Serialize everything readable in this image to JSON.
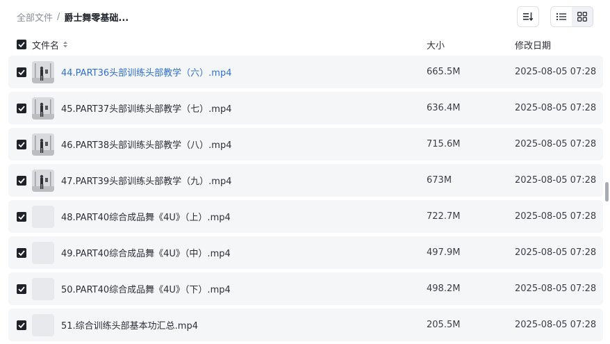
{
  "breadcrumb": {
    "root": "全部文件",
    "separator": "/",
    "current": "爵士舞零基础..."
  },
  "toolbar": {
    "sort_icon": "sort-icon",
    "list_view_icon": "list-view-icon",
    "grid_view_icon": "grid-view-icon"
  },
  "table": {
    "headers": {
      "name": "文件名",
      "size": "大小",
      "modified": "修改日期"
    },
    "rows": [
      {
        "name": "44.PART36头部训练头部教学（六）.mp4",
        "size": "665.5M",
        "modified": "2025-08-05 07:28",
        "thumb": "video",
        "highlight": true
      },
      {
        "name": "45.PART37头部训练头部教学（七）.mp4",
        "size": "636.4M",
        "modified": "2025-08-05 07:28",
        "thumb": "video",
        "highlight": false
      },
      {
        "name": "46.PART38头部训练头部教学（八）.mp4",
        "size": "715.6M",
        "modified": "2025-08-05 07:28",
        "thumb": "video",
        "highlight": false
      },
      {
        "name": "47.PART39头部训练头部教学（九）.mp4",
        "size": "673M",
        "modified": "2025-08-05 07:28",
        "thumb": "video",
        "highlight": false
      },
      {
        "name": "48.PART40综合成品舞《4U》（上）.mp4",
        "size": "722.7M",
        "modified": "2025-08-05 07:28",
        "thumb": "empty",
        "highlight": false
      },
      {
        "name": "49.PART40综合成品舞《4U》（中）.mp4",
        "size": "497.9M",
        "modified": "2025-08-05 07:28",
        "thumb": "empty",
        "highlight": false
      },
      {
        "name": "50.PART40综合成品舞《4U》（下）.mp4",
        "size": "498.2M",
        "modified": "2025-08-05 07:28",
        "thumb": "empty",
        "highlight": false
      },
      {
        "name": "51.综合训练头部基本功汇总.mp4",
        "size": "205.5M",
        "modified": "2025-08-05 07:28",
        "thumb": "empty",
        "highlight": false
      }
    ]
  },
  "colors": {
    "link": "#2f6fd6",
    "row_bg": "#f5f6f8",
    "checkbox": "#1f2329"
  }
}
